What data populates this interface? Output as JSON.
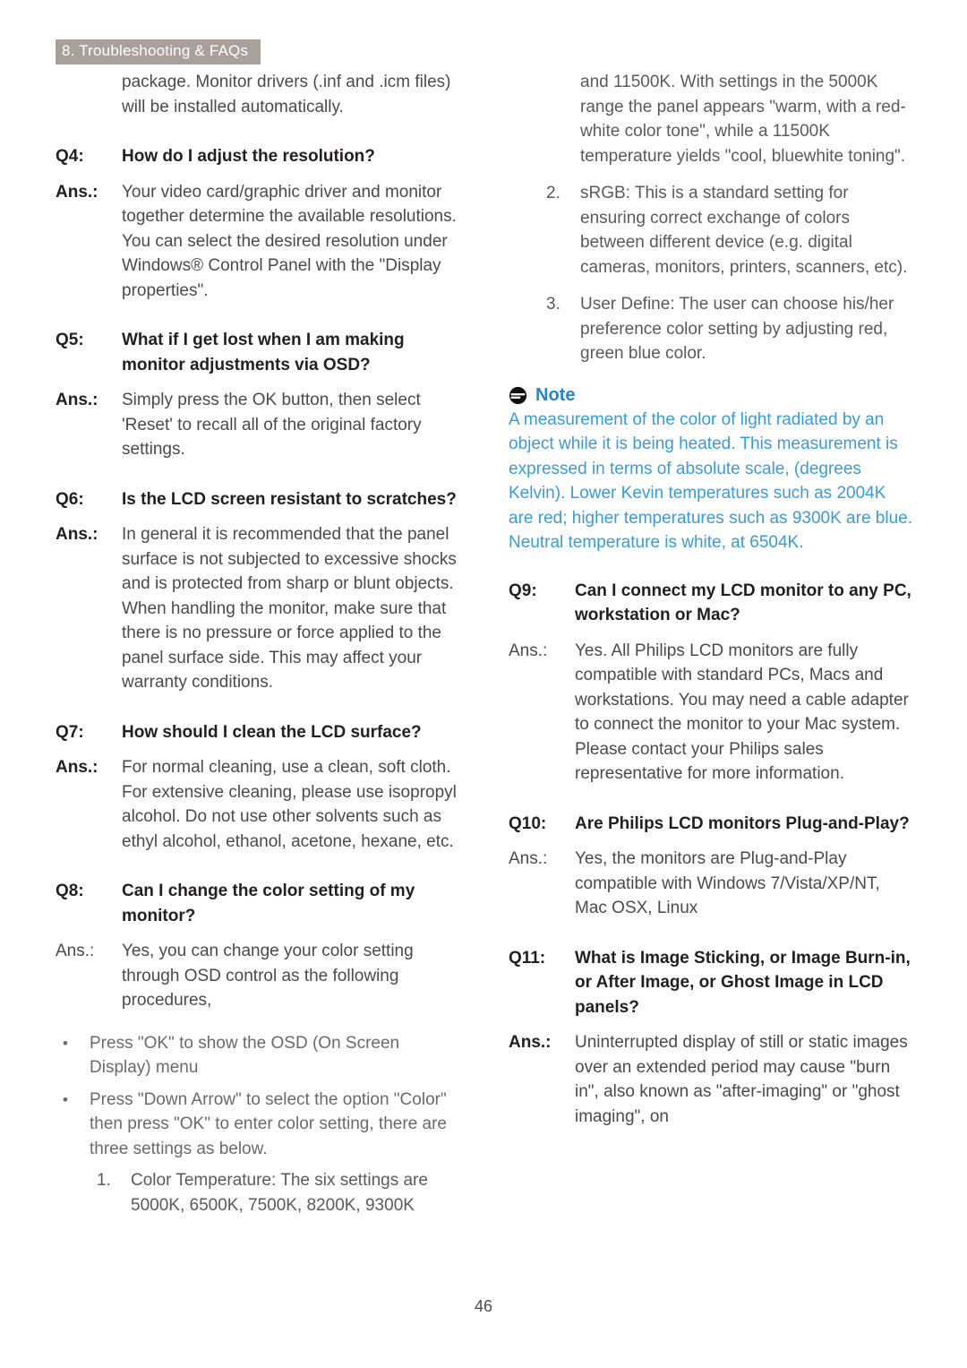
{
  "header": {
    "chapter_tab": "8. Troubleshooting & FAQs",
    "tab_bg_color": "#a9a09b",
    "tab_text_color": "#ffffff"
  },
  "footer": {
    "page_number": "46"
  },
  "colors": {
    "body_text": "#4a4a4a",
    "heading_text": "#231f20",
    "note_title": "#2487c8",
    "note_body": "#3b9bd6"
  },
  "left_column": {
    "continued_paragraph": "package. Monitor drivers (.inf and .icm files) will be installed automatically.",
    "q4": {
      "label": "Q4:",
      "question": "How do I adjust the resolution?",
      "ans_label": "Ans.:",
      "answer": "Your video card/graphic driver and monitor together determine the available resolutions. You can select the desired resolution under Windows® Control Panel with the \"Display properties\"."
    },
    "q5": {
      "label": "Q5:",
      "question": "What if I get lost when I am making monitor adjustments via OSD?",
      "ans_label": "Ans.:",
      "answer": "Simply press the OK  button, then select 'Reset' to recall all of the original factory settings."
    },
    "q6": {
      "label": "Q6:",
      "question": "Is the LCD screen resistant to scratches?",
      "ans_label": "Ans.:",
      "answer": "In general it is recommended that the panel surface is not subjected to excessive shocks and is protected from sharp or blunt objects. When handling the monitor, make sure that there is no pressure or force applied to the panel surface side. This may affect your warranty conditions."
    },
    "q7": {
      "label": "Q7:",
      "question": "How should I clean the LCD surface?",
      "ans_label": "Ans.:",
      "answer": "For normal cleaning, use a clean, soft cloth. For extensive cleaning, please use isopropyl alcohol. Do not use other solvents such as ethyl alcohol, ethanol, acetone, hexane, etc."
    },
    "q8": {
      "label": "Q8:",
      "question": "Can I change the color setting of my monitor?",
      "ans_label": "Ans.:",
      "answer": "Yes, you can change your color setting through OSD control as the following procedures,"
    },
    "bullets": [
      {
        "mark": "•",
        "text": "Press \"OK\" to show the OSD (On Screen Display) menu"
      },
      {
        "mark": "•",
        "text": "Press \"Down Arrow\" to select the option \"Color\" then press \"OK\" to enter color setting, there are three settings as below."
      }
    ],
    "numbered": [
      {
        "mark": "1.",
        "text": "Color Temperature: The six settings are 5000K, 6500K, 7500K, 8200K, 9300K"
      }
    ]
  },
  "right_column": {
    "numbered_continuation": "and 11500K. With settings in the 5000K range the panel appears \"warm, with a red-white color tone\", while a 11500K temperature yields \"cool, bluewhite toning\".",
    "numbered": [
      {
        "mark": "2.",
        "text": "sRGB: This is a standard setting for ensuring correct exchange of colors between different device (e.g. digital cameras, monitors, printers, scanners, etc)."
      },
      {
        "mark": "3.",
        "text": "User Define: The user can choose his/her preference color setting by adjusting red, green blue color."
      }
    ],
    "note": {
      "icon": "note-icon",
      "title": "Note",
      "body": "A measurement of the color of light radiated by an object while it is being heated. This measurement is expressed in terms of absolute scale, (degrees Kelvin). Lower Kevin temperatures such as 2004K are red; higher temperatures such as 9300K are blue. Neutral temperature is white, at 6504K."
    },
    "q9": {
      "label": "Q9:",
      "question": "Can I connect my LCD monitor to any PC, workstation or Mac?",
      "ans_label": "Ans.:",
      "answer": "Yes. All Philips LCD monitors are fully compatible with standard PCs, Macs and workstations. You may need a cable adapter to connect the monitor to your Mac system. Please contact your Philips sales representative for more information."
    },
    "q10": {
      "label": "Q10:",
      "question": "Are Philips LCD monitors Plug-and-Play?",
      "ans_label": "Ans.:",
      "answer": "Yes, the monitors are Plug-and-Play compatible with Windows 7/Vista/XP/NT, Mac OSX, Linux"
    },
    "q11": {
      "label": "Q11:",
      "question": "What is Image Sticking, or Image Burn-in, or After Image, or Ghost Image in LCD panels?",
      "ans_label": "Ans.:",
      "answer": "Uninterrupted display of still or static images over an extended period may cause \"burn in\", also known as \"after-imaging\" or \"ghost imaging\", on"
    }
  }
}
